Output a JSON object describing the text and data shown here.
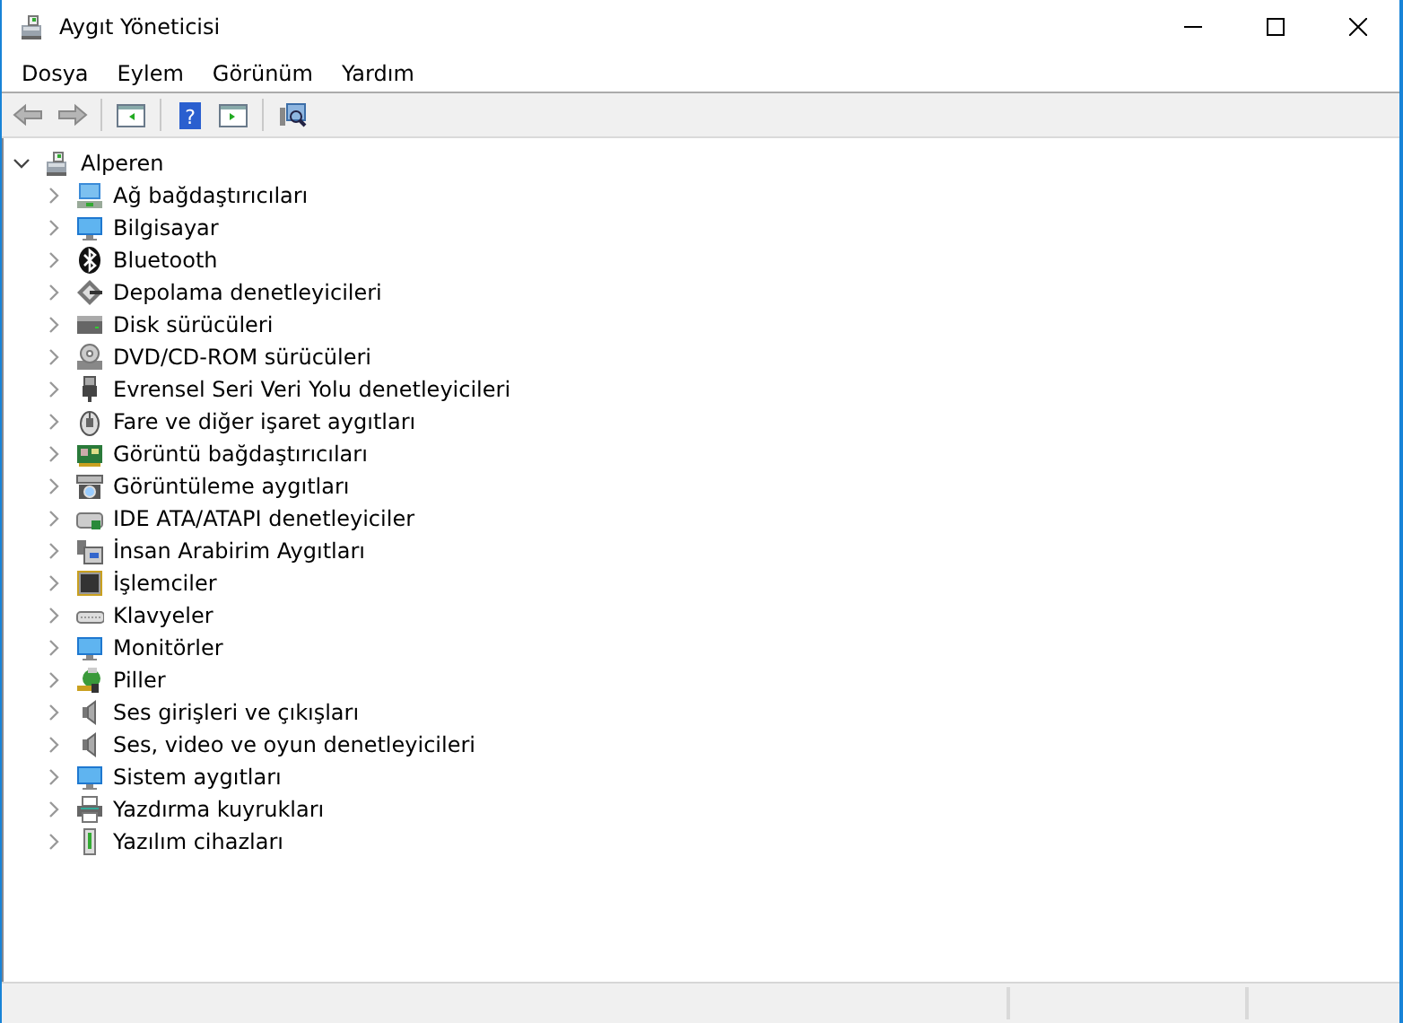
{
  "window": {
    "title": "Aygıt Yöneticisi"
  },
  "menu": [
    "Dosya",
    "Eylem",
    "Görünüm",
    "Yardım"
  ],
  "toolbar": {
    "help_glyph": "?"
  },
  "tree": {
    "label": "Alperen",
    "expanded": true,
    "children": [
      {
        "label": "Ağ bağdaştırıcıları",
        "expanded": false
      },
      {
        "label": "Bilgisayar",
        "expanded": false
      },
      {
        "label": "Bluetooth",
        "expanded": false
      },
      {
        "label": "Depolama denetleyicileri",
        "expanded": false
      },
      {
        "label": "Disk sürücüleri",
        "expanded": false
      },
      {
        "label": "DVD/CD-ROM sürücüleri",
        "expanded": false
      },
      {
        "label": "Evrensel Seri Veri Yolu denetleyicileri",
        "expanded": false
      },
      {
        "label": "Fare ve diğer işaret aygıtları",
        "expanded": false
      },
      {
        "label": "Görüntü bağdaştırıcıları",
        "expanded": false
      },
      {
        "label": "Görüntüleme aygıtları",
        "expanded": false
      },
      {
        "label": "IDE ATA/ATAPI denetleyiciler",
        "expanded": false
      },
      {
        "label": "İnsan Arabirim Aygıtları",
        "expanded": false
      },
      {
        "label": "İşlemciler",
        "expanded": false
      },
      {
        "label": "Klavyeler",
        "expanded": false
      },
      {
        "label": "Monitörler",
        "expanded": false
      },
      {
        "label": "Piller",
        "expanded": false
      },
      {
        "label": "Ses girişleri ve çıkışları",
        "expanded": false
      },
      {
        "label": "Ses, video ve oyun denetleyicileri",
        "expanded": false
      },
      {
        "label": "Sistem aygıtları",
        "expanded": false
      },
      {
        "label": "Yazdırma kuyrukları",
        "expanded": false
      },
      {
        "label": "Yazılım cihazları",
        "expanded": false
      }
    ]
  }
}
